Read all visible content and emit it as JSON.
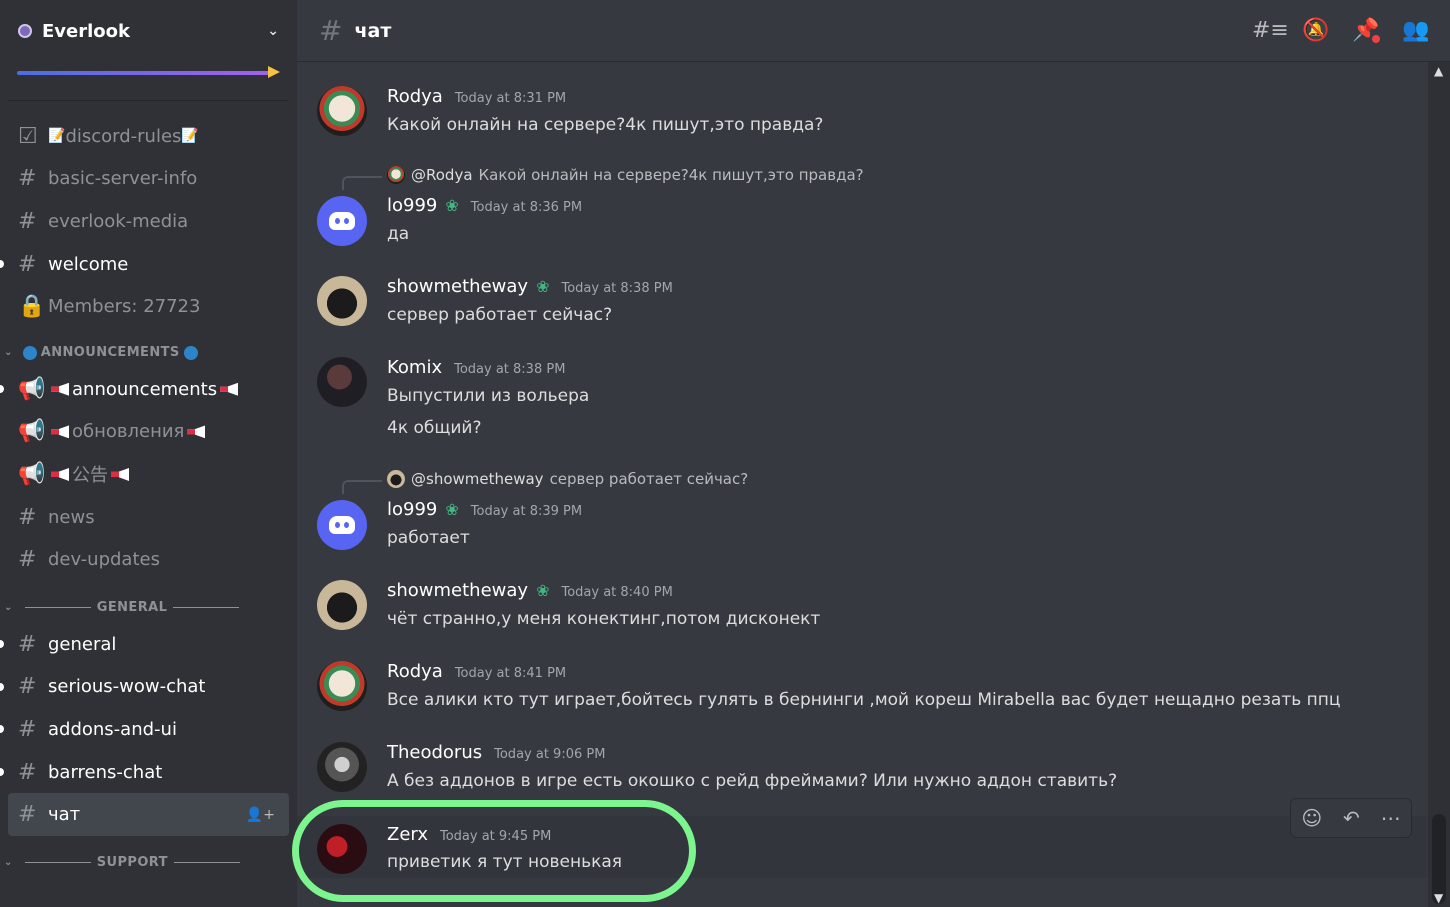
{
  "server": {
    "name": "Everlook"
  },
  "channels_top": [
    {
      "label": "discord-rules",
      "icon": "rules-icon",
      "unread": false
    },
    {
      "label": "basic-server-info",
      "icon": "hash-icon",
      "unread": false
    },
    {
      "label": "everlook-media",
      "icon": "hash-icon",
      "unread": false
    },
    {
      "label": "welcome",
      "icon": "hash-icon",
      "unread": true
    },
    {
      "label": "Members: 27723",
      "icon": "lock-icon",
      "unread": false
    }
  ],
  "cat_announcements": {
    "label": "ANNOUNCEMENTS"
  },
  "channels_ann": [
    {
      "label": "announcements",
      "icon": "announcement-icon",
      "unread": true
    },
    {
      "label": "обновления",
      "icon": "announcement-icon",
      "unread": false
    },
    {
      "label": "公告",
      "icon": "announcement-icon",
      "unread": false
    },
    {
      "label": "news",
      "icon": "hash-icon",
      "unread": false
    },
    {
      "label": "dev-updates",
      "icon": "hash-icon",
      "unread": false
    }
  ],
  "cat_general": {
    "label": "GENERAL"
  },
  "channels_gen": [
    {
      "label": "general",
      "icon": "hash-icon",
      "unread": true
    },
    {
      "label": "serious-wow-chat",
      "icon": "hash-icon",
      "unread": true
    },
    {
      "label": "addons-and-ui",
      "icon": "hash-icon",
      "unread": true
    },
    {
      "label": "barrens-chat",
      "icon": "hash-icon",
      "unread": true
    },
    {
      "label": "чат",
      "icon": "hash-icon",
      "unread": false,
      "active": true
    }
  ],
  "cat_support": {
    "label": "SUPPORT"
  },
  "topbar": {
    "channel": "чат"
  },
  "messages": [
    {
      "user": "Rodya",
      "time": "Today at 8:31 PM",
      "text": "Какой онлайн на сервере?4к пишут,это правда?"
    },
    {
      "reply_to": "@Rodya",
      "reply_text": "Какой онлайн на сервере?4к пишут,это правда?",
      "user": "lo999",
      "time": "Today at 8:36 PM",
      "text": "да"
    },
    {
      "user": "showmetheway",
      "time": "Today at 8:38 PM",
      "text": "сервер работает сейчас?"
    },
    {
      "user": "Komix",
      "time": "Today at 8:38 PM",
      "text": "Выпустили из вольера",
      "text2": "4к общий?"
    },
    {
      "reply_to": "@showmetheway",
      "reply_text": "сервер работает сейчас?",
      "user": "lo999",
      "time": "Today at 8:39 PM",
      "text": "работает"
    },
    {
      "user": "showmetheway",
      "time": "Today at 8:40 PM",
      "text": "чёт странно,у меня конектинг,потом дисконект"
    },
    {
      "user": "Rodya",
      "time": "Today at 8:41 PM",
      "text": "Все алики кто тут играет,бойтесь гулять в бернинги ,мой кореш Mirabella вас будет нещадно резать ппц"
    },
    {
      "user": "Theodorus",
      "time": "Today at 9:06 PM",
      "text": "А без аддонов в игре есть окошко с рейд фреймами? Или нужно аддон ставить?"
    },
    {
      "user": "Zerx",
      "time": "Today at 9:45 PM",
      "text": "приветик я тут новенькая"
    }
  ]
}
